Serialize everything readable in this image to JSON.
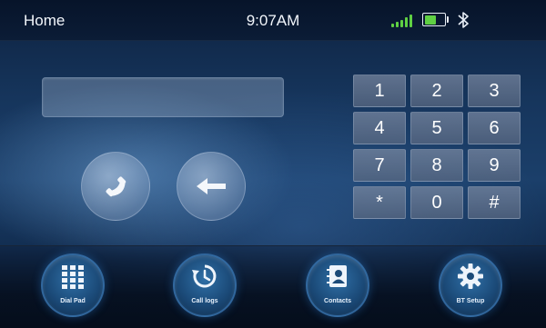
{
  "status_bar": {
    "home_label": "Home",
    "time": "9:07AM",
    "signal_icon": "signal-bars-icon",
    "battery_icon": "battery-icon",
    "bluetooth_icon": "bluetooth-icon",
    "accent_color": "#5fd043"
  },
  "dialer": {
    "display_value": "",
    "call_button_icon": "phone-handset-icon",
    "backspace_button_icon": "left-arrow-icon"
  },
  "keypad": {
    "keys": [
      "1",
      "2",
      "3",
      "4",
      "5",
      "6",
      "7",
      "8",
      "9",
      "*",
      "0",
      "#"
    ]
  },
  "dock": {
    "items": [
      {
        "label": "Dial Pad",
        "icon": "grid-icon"
      },
      {
        "label": "Call logs",
        "icon": "history-clock-icon"
      },
      {
        "label": "Contacts",
        "icon": "contacts-book-icon"
      },
      {
        "label": "BT Setup",
        "icon": "gear-icon"
      }
    ]
  }
}
